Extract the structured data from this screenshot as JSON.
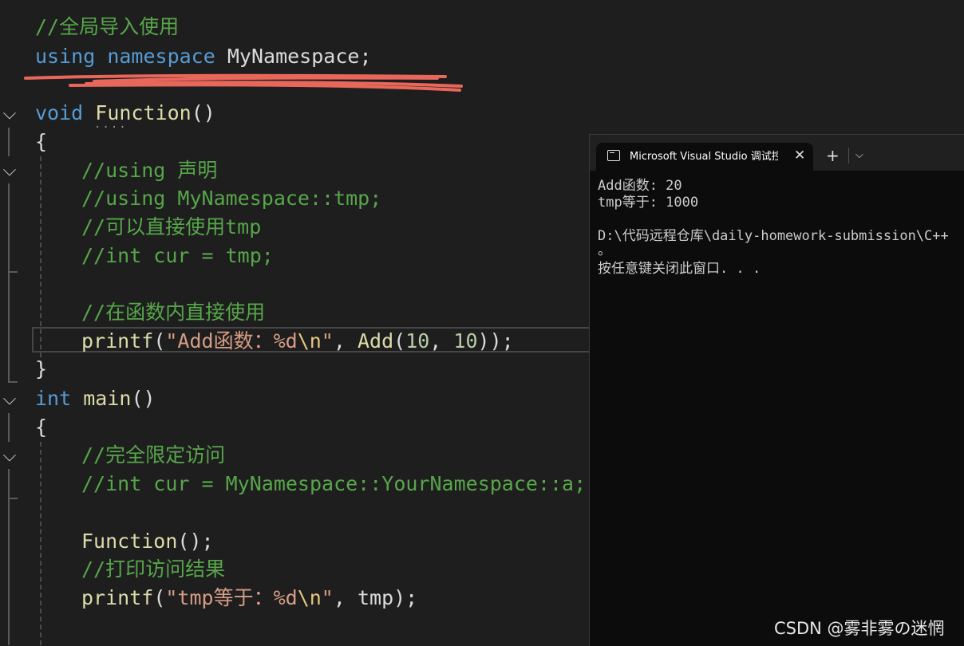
{
  "editor": {
    "lines": {
      "l1": "//全局导入使用",
      "l2_kw1": "using",
      "l2_kw2": "namespace",
      "l2_name": "MyNamespace",
      "l2_semi": ";",
      "l3_kw": "void",
      "l3_func": "Function",
      "l3_paren": "()",
      "l4": "{",
      "l5": "//using 声明",
      "l6": "//using MyNamespace::tmp;",
      "l7": "//可以直接使用tmp",
      "l8": "//int cur = tmp;",
      "l9": "//在函数内直接使用",
      "l10_func": "printf",
      "l10_open": "(",
      "l10_str": "\"Add函数：%d",
      "l10_esc": "\\n",
      "l10_strend": "\"",
      "l10_comma": ", ",
      "l10_func2": "Add",
      "l10_open2": "(",
      "l10_num1": "10",
      "l10_comma2": ", ",
      "l10_num2": "10",
      "l10_close": "));",
      "l11": "}",
      "l12_kw": "int",
      "l12_func": "main",
      "l12_paren": "()",
      "l13": "{",
      "l14": "//完全限定访问",
      "l15": "//int cur = MyNamespace::YourNamespace::a;",
      "l16_func": "Function",
      "l16_rest": "();",
      "l17": "//打印访问结果",
      "l18_func": "printf",
      "l18_open": "(",
      "l18_str": "\"tmp等于：%d",
      "l18_esc": "\\n",
      "l18_strend": "\"",
      "l18_comma": ", ",
      "l18_var": "tmp",
      "l18_close": ");"
    },
    "colors": {
      "comment": "#57a64a",
      "keyword": "#569cd6",
      "function": "#dcdcaa",
      "string": "#d69d85",
      "number": "#b5cea8",
      "annotation": "#e8675a"
    }
  },
  "console": {
    "tab_title": "Microsoft Visual Studio 调试控制台",
    "tab_icon": "terminal-icon",
    "close_glyph": "✕",
    "new_tab_glyph": "+",
    "dropdown_glyph": "⌵",
    "output": {
      "line1": "Add函数: 20",
      "line2": "tmp等于: 1000",
      "line3": "",
      "line4": "D:\\代码远程仓库\\daily-homework-submission\\C++",
      "line5": "。",
      "line6": "按任意键关闭此窗口. . ."
    }
  },
  "watermark": "CSDN @雾非雾の迷惘"
}
